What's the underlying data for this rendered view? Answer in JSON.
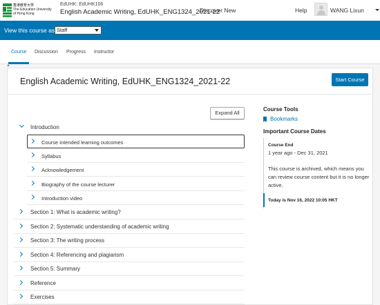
{
  "header": {
    "logo": {
      "line1": "香港教育大學",
      "line2": "The Education University",
      "line3": "of Hong Kong"
    },
    "course_org": "EdUHK: EdUHK106",
    "course_title": "English Academic Writing, EdUHK_ENG1324_2021-22",
    "discover": "Discover New",
    "help": "Help",
    "username": "WANG Lixun"
  },
  "viewbar": {
    "label": "View this course as:",
    "selected": "Staff"
  },
  "tabs": [
    {
      "label": "Course",
      "active": true
    },
    {
      "label": "Discussion",
      "active": false
    },
    {
      "label": "Progress",
      "active": false
    },
    {
      "label": "Instructor",
      "active": false
    }
  ],
  "main": {
    "title": "English Academic Writing, EdUHK_ENG1324_2021-22",
    "start_button": "Start Course",
    "expand_button": "Expand All"
  },
  "outline": {
    "intro": "Introduction",
    "subs": [
      "Course intended learning outcomes",
      "Syllabus",
      "Acknowledgement",
      "Biography of the course lecturer",
      "Introduction video"
    ],
    "sections": [
      "Section 1: What is academic writing?",
      "Section 2: Systematic understanding of academic writing",
      "Section 3: The writing process",
      "Section 4: Referencing and plagiarism",
      "Section 5: Summary",
      "Reference",
      "Exercises"
    ]
  },
  "sidebar": {
    "tools_heading": "Course Tools",
    "bookmarks": "Bookmarks",
    "dates_heading": "Important Course Dates",
    "course_end_heading": "Course End",
    "course_end_value": "1 year ago - Dec 31, 2021",
    "archived_text": "This course is archived, which means you can review course content but it is no longer active.",
    "today": "Today is Nov 16, 2022 10:05 HKT"
  },
  "colors": {
    "accent": "#0075b4"
  }
}
